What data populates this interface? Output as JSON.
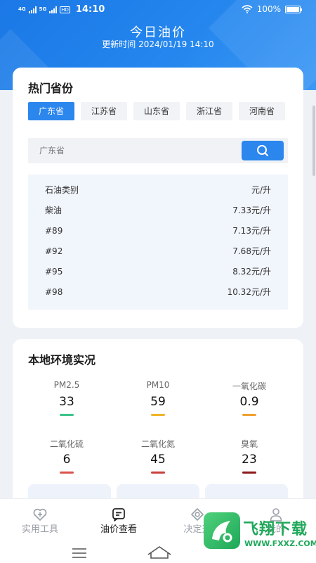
{
  "status_bar": {
    "network_1": "4G",
    "network_2": "5G",
    "hd": "HD",
    "time": "14:10",
    "battery": "100%"
  },
  "header": {
    "title": "今日油价",
    "update_time": "更新时间 2024/01/19 14:10"
  },
  "hot_provinces": {
    "title": "热门省份",
    "tabs": [
      "广东省",
      "江苏省",
      "山东省",
      "浙江省",
      "河南省"
    ],
    "active_tab": "广东省"
  },
  "search": {
    "value": "",
    "placeholder": "广东省"
  },
  "price_table": {
    "header": {
      "name": "石油类别",
      "unit": "元/升"
    },
    "rows": [
      {
        "name": "柴油",
        "price": "7.33元/升"
      },
      {
        "name": "#89",
        "price": "7.13元/升"
      },
      {
        "name": "#92",
        "price": "7.68元/升"
      },
      {
        "name": "#95",
        "price": "8.32元/升"
      },
      {
        "name": "#98",
        "price": "10.32元/升"
      }
    ]
  },
  "environment": {
    "title": "本地环境实况",
    "items": [
      {
        "label": "PM2.5",
        "value": "33",
        "color": "#3cc38a"
      },
      {
        "label": "PM10",
        "value": "59",
        "color": "#f0b429"
      },
      {
        "label": "一氧化碳",
        "value": "0.9",
        "color": "#f0a030"
      },
      {
        "label": "二氧化硫",
        "value": "6",
        "color": "#d9534f"
      },
      {
        "label": "二氧化氮",
        "value": "45",
        "color": "#c9403c"
      },
      {
        "label": "臭氧",
        "value": "23",
        "color": "#8b1a1a"
      }
    ]
  },
  "bottom_nav": {
    "items": [
      {
        "label": "实用工具",
        "icon": "heart-plus-icon"
      },
      {
        "label": "油价查看",
        "icon": "message-icon"
      },
      {
        "label": "决定天",
        "icon": "eye-icon"
      },
      {
        "label": "我的",
        "icon": "user-icon"
      }
    ],
    "active": "油价查看"
  },
  "watermark": {
    "name": "飞翔下载",
    "url": "WWW.FXXZ.COM"
  },
  "colors": {
    "brand": "#2b86ee",
    "header_gradient_start": "#1b78e6",
    "watermark_green": "#1fa85a"
  }
}
